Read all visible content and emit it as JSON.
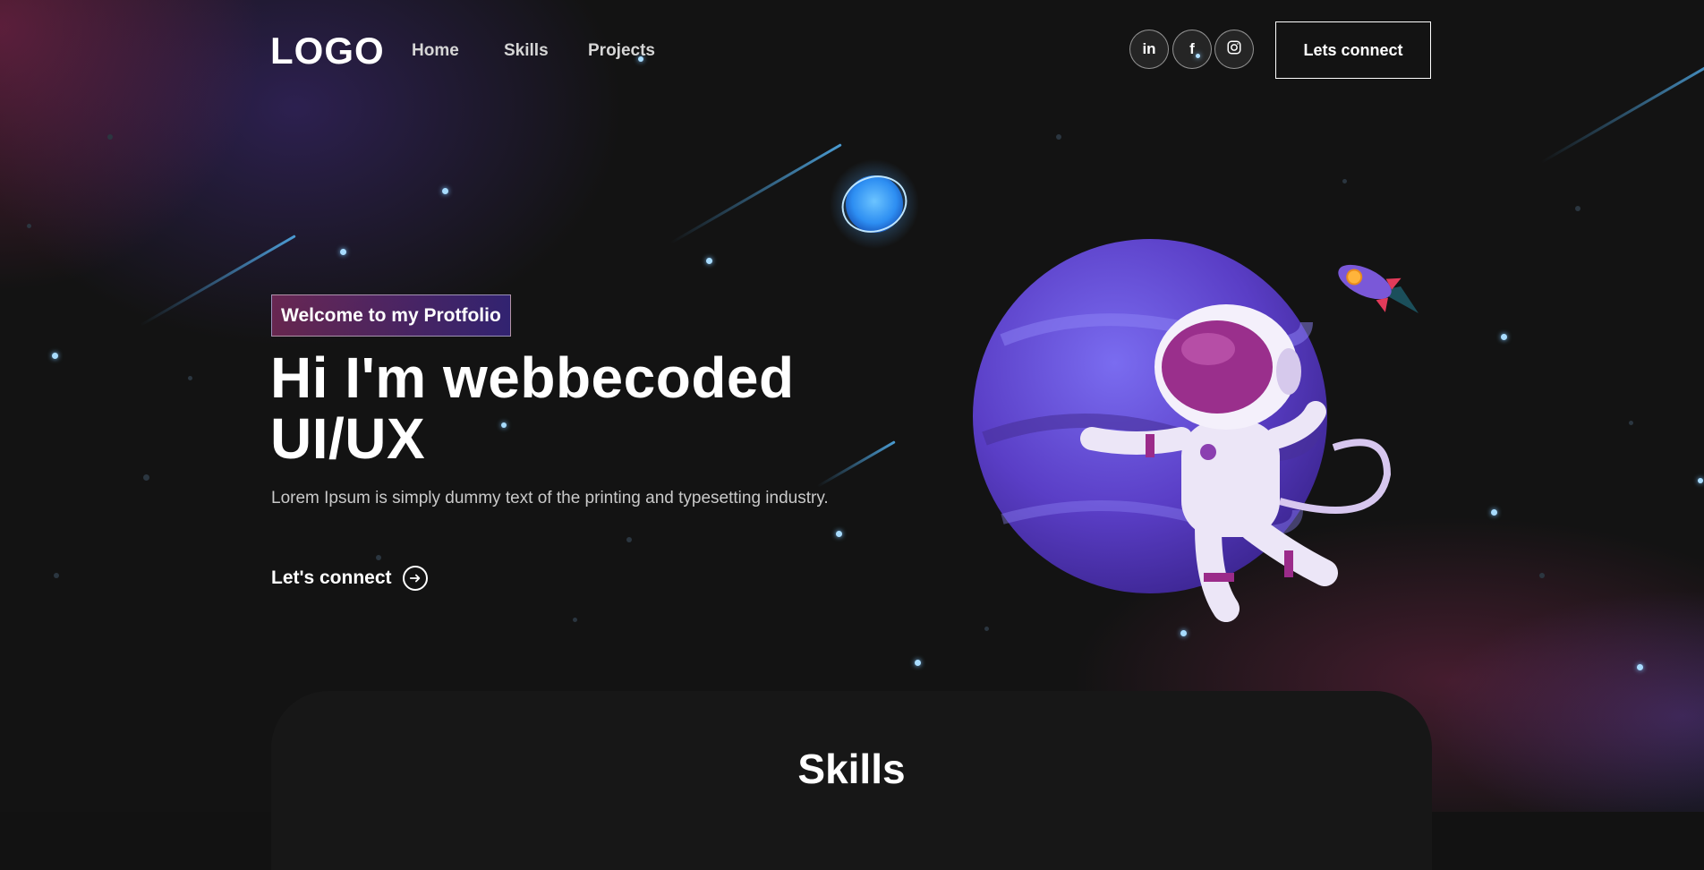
{
  "nav": {
    "logo": "LOGO",
    "links": [
      "Home",
      "Skills",
      "Projects"
    ],
    "social": [
      {
        "icon": "linkedin-icon",
        "label": "in"
      },
      {
        "icon": "facebook-icon",
        "label": "f"
      },
      {
        "icon": "instagram-icon",
        "label": ""
      }
    ],
    "cta_label": "Lets connect"
  },
  "hero": {
    "tagline": "Welcome to my Protfolio",
    "headline_line1": "Hi I'm webbecoded",
    "headline_line2": "UI/UX",
    "subtitle": "Lorem Ipsum is simply dummy text of the printing and typesetting industry.",
    "connect_label": "Let's connect",
    "illustration": "astronaut-planet-illustration"
  },
  "skills": {
    "title": "Skills"
  },
  "colors": {
    "background": "#121212",
    "accent_pink": "#aa367c",
    "accent_purple": "#4a2fbd",
    "star": "#a8dcff"
  }
}
